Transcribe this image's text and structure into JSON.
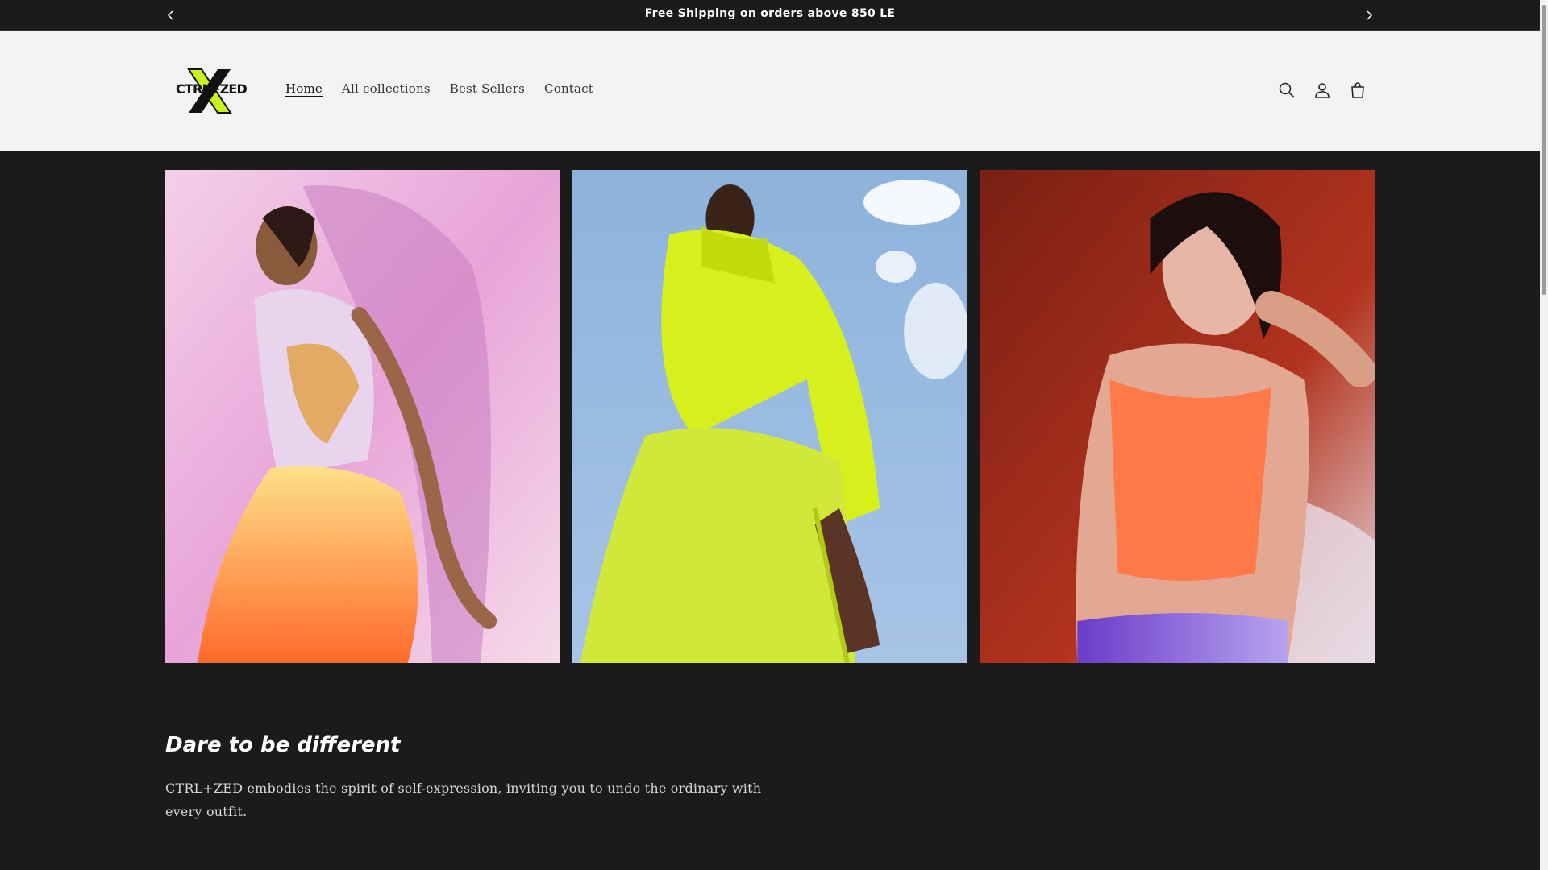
{
  "announcement": {
    "text": "Free Shipping on orders above 850 LE",
    "prev_icon": "chevron-left-icon",
    "next_icon": "chevron-right-icon"
  },
  "header": {
    "logo_text": "CTRL+ZED",
    "nav": [
      {
        "label": "Home",
        "active": true
      },
      {
        "label": "All collections"
      },
      {
        "label": "Best Sellers"
      },
      {
        "label": "Contact"
      }
    ],
    "icons": [
      "search-icon",
      "account-icon",
      "cart-icon"
    ]
  },
  "gallery": {
    "images": [
      {
        "description_tag": "model-pink-backdrop",
        "colors": [
          "#f3cfe6",
          "#ff8a3d"
        ]
      },
      {
        "description_tag": "model-neon-jacket-sky",
        "colors": [
          "#8fb4dc",
          "#d7ef1c"
        ]
      },
      {
        "description_tag": "model-orange-top-red-backdrop",
        "colors": [
          "#b2331e",
          "#ff7a48"
        ]
      }
    ]
  },
  "content": {
    "title": "Dare to be different",
    "body": "CTRL+ZED embodies the spirit of self-expression, inviting you to undo the ordinary with every outfit."
  },
  "colors": {
    "background": "#1b1b1b",
    "header_bg": "#f3f3f3",
    "accent": "#c9f31d"
  }
}
